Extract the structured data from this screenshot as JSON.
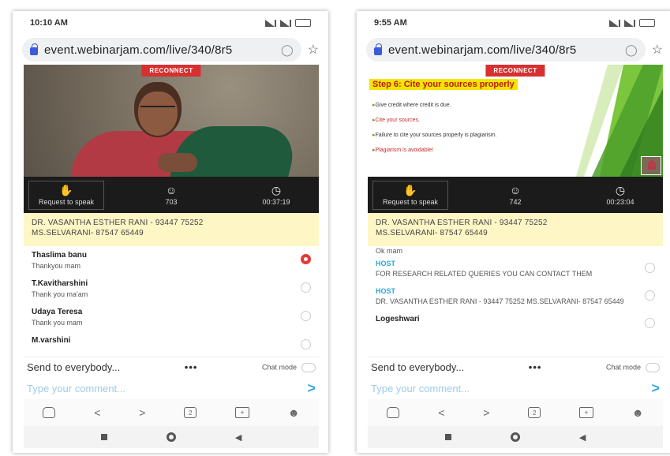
{
  "phones": {
    "left": {
      "time": "10:10 AM",
      "url": "event.webinarjam.com/live/340/8r5",
      "reconnect": "RECONNECT",
      "controls": {
        "request": "Request to speak",
        "attendees": "703",
        "timer": "00:37:19"
      },
      "info_line1": "DR. VASANTHA ESTHER RANI - 93447 75252",
      "info_line2": "MS.SELVARANI- 87547 65449",
      "messages": [
        {
          "name": "Thaslima banu",
          "text": "Thankyou mam"
        },
        {
          "name": "T.Kavitharshini",
          "text": "Thank you ma'am"
        },
        {
          "name": "Udaya Teresa",
          "text": "Thank you mam"
        },
        {
          "name": "M.varshini",
          "text": ""
        }
      ],
      "send_to": "Send to everybody...",
      "more": "•••",
      "chat_mode": "Chat mode",
      "comment_placeholder": "Type your comment...",
      "tab_count": "2"
    },
    "right": {
      "time": "9:55 AM",
      "url": "event.webinarjam.com/live/340/8r5",
      "reconnect": "RECONNECT",
      "slide_title": "Step 6: Cite your sources properly",
      "slide_bullets": [
        "Give credit where credit is due.",
        "Cite your sources.",
        "Failure to cite your sources properly is plagiarism.",
        "Plagiarism is avoidable!"
      ],
      "controls": {
        "request": "Request to speak",
        "attendees": "742",
        "timer": "00:23:04"
      },
      "info_line1": "DR. VASANTHA ESTHER RANI - 93447 75252",
      "info_line2": "MS.SELVARANI- 87547 65449",
      "top_partial": "Ok mam",
      "host_label": "HOST",
      "host_msg1": "FOR RESEARCH RELATED QUERIES YOU CAN CONTACT THEM",
      "host_msg2": "DR. VASANTHA ESTHER RANI - 93447 75252 MS.SELVARANI- 87547 65449",
      "last_name": "Logeshwari",
      "send_to": "Send to everybody...",
      "more": "•••",
      "chat_mode": "Chat mode",
      "comment_placeholder": "Type your comment...",
      "tab_count": "2"
    }
  },
  "colors": {
    "reconnect": "#d63031",
    "host": "#2aa7d8",
    "info_bg": "#fff6c6",
    "controls_bg": "#1b1b1b",
    "slide_title_bg": "#f5e400"
  }
}
